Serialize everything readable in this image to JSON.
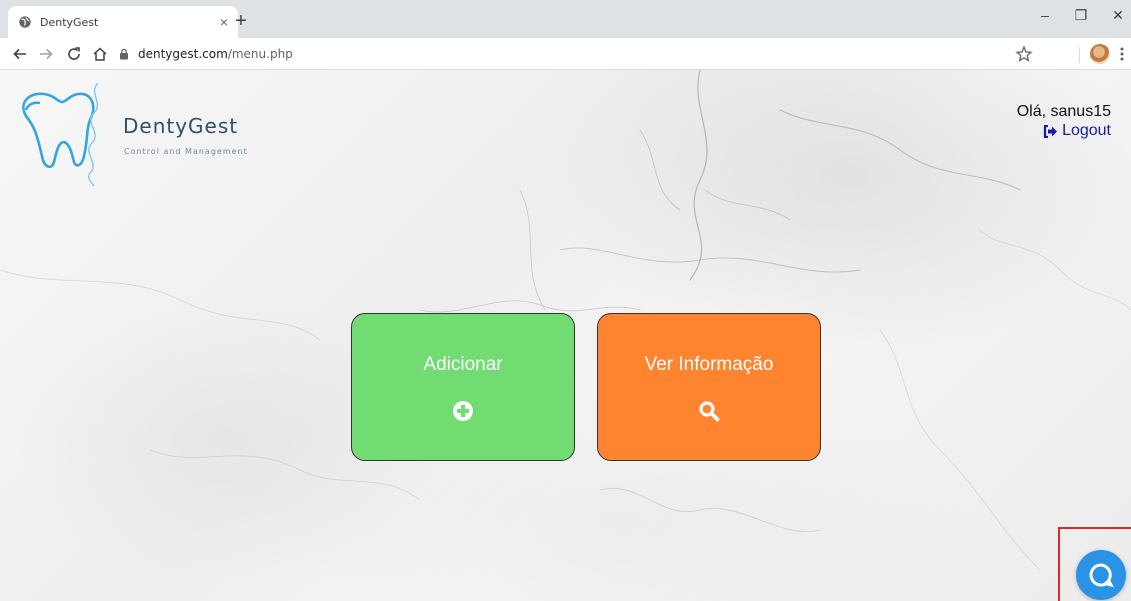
{
  "browser": {
    "tab_title": "DentyGest",
    "tab_close": "×",
    "new_tab": "+",
    "window_controls": {
      "minimize": "–",
      "restore": "❐",
      "close": "✕"
    },
    "url_domain": "dentygest.com",
    "url_path": "/menu.php"
  },
  "header": {
    "brand_name": "DentyGest",
    "brand_tagline": "Control and Management",
    "greeting": "Olá, sanus15",
    "logout_label": "Logout"
  },
  "menu": {
    "add_label": "Adicionar",
    "view_label": "Ver Informação"
  },
  "colors": {
    "add_card": "#70dc71",
    "view_card": "#ff8430",
    "chat_button": "#2a93e6",
    "brand_text": "#2f4f6f",
    "highlight_outline": "#e3262a"
  },
  "icons": {
    "add": "plus-circle-icon",
    "view": "search-icon",
    "logout": "sign-out-icon",
    "chat": "chat-bubble-icon"
  }
}
